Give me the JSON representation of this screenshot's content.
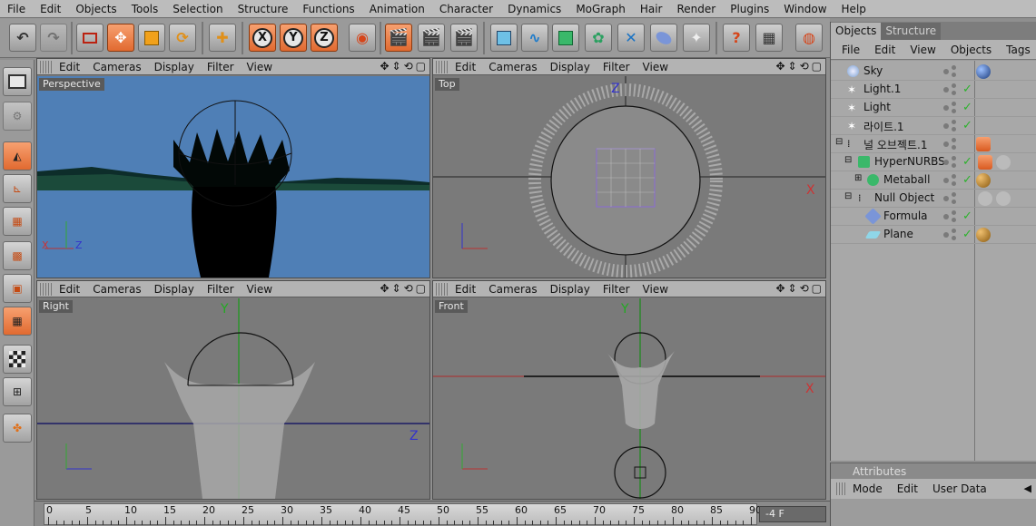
{
  "menubar": [
    "File",
    "Edit",
    "Objects",
    "Tools",
    "Selection",
    "Structure",
    "Functions",
    "Animation",
    "Character",
    "Dynamics",
    "MoGraph",
    "Hair",
    "Render",
    "Plugins",
    "Window",
    "Help"
  ],
  "viewport_menu": [
    "Edit",
    "Cameras",
    "Display",
    "Filter",
    "View"
  ],
  "viewports": {
    "perspective": {
      "label": "Perspective"
    },
    "top": {
      "label": "Top"
    },
    "right": {
      "label": "Right"
    },
    "front": {
      "label": "Front"
    }
  },
  "axis_letters": {
    "x": "X",
    "y": "Y",
    "z": "Z"
  },
  "toolbar_axis": {
    "x": "X",
    "y": "Y",
    "z": "Z"
  },
  "objects_panel": {
    "tabs": [
      "Objects",
      "Structure"
    ],
    "menu": [
      "File",
      "Edit",
      "View",
      "Objects",
      "Tags"
    ],
    "items": [
      {
        "name": "Sky",
        "indent": 0,
        "icon": "sky-icon"
      },
      {
        "name": "Light.1",
        "indent": 0,
        "icon": "light-icon"
      },
      {
        "name": "Light",
        "indent": 0,
        "icon": "light-icon"
      },
      {
        "name": "라이트.1",
        "indent": 0,
        "icon": "light-icon"
      },
      {
        "name": "널 오브젝트.1",
        "indent": 0,
        "icon": "null-icon"
      },
      {
        "name": "HyperNURBS",
        "indent": 1,
        "icon": "hypernurbs-icon"
      },
      {
        "name": "Metaball",
        "indent": 2,
        "icon": "metaball-icon"
      },
      {
        "name": "Null Object",
        "indent": 1,
        "icon": "null-icon"
      },
      {
        "name": "Formula",
        "indent": 2,
        "icon": "formula-icon"
      },
      {
        "name": "Plane",
        "indent": 2,
        "icon": "plane-icon"
      }
    ]
  },
  "attributes_panel": {
    "title": "Attributes",
    "menu": [
      "Mode",
      "Edit",
      "User Data"
    ]
  },
  "timeline": {
    "labels": [
      "0",
      "5",
      "10",
      "15",
      "20",
      "25",
      "30",
      "35",
      "40",
      "45",
      "50",
      "55",
      "60",
      "65",
      "70",
      "75",
      "80",
      "85",
      "90"
    ],
    "current_frame": "-4 F"
  },
  "colors": {
    "accent": "#e36d33",
    "viewport_bg": "#7a7a7a",
    "perspective_sky": "#4f7fb6",
    "check": "#2db22d"
  }
}
